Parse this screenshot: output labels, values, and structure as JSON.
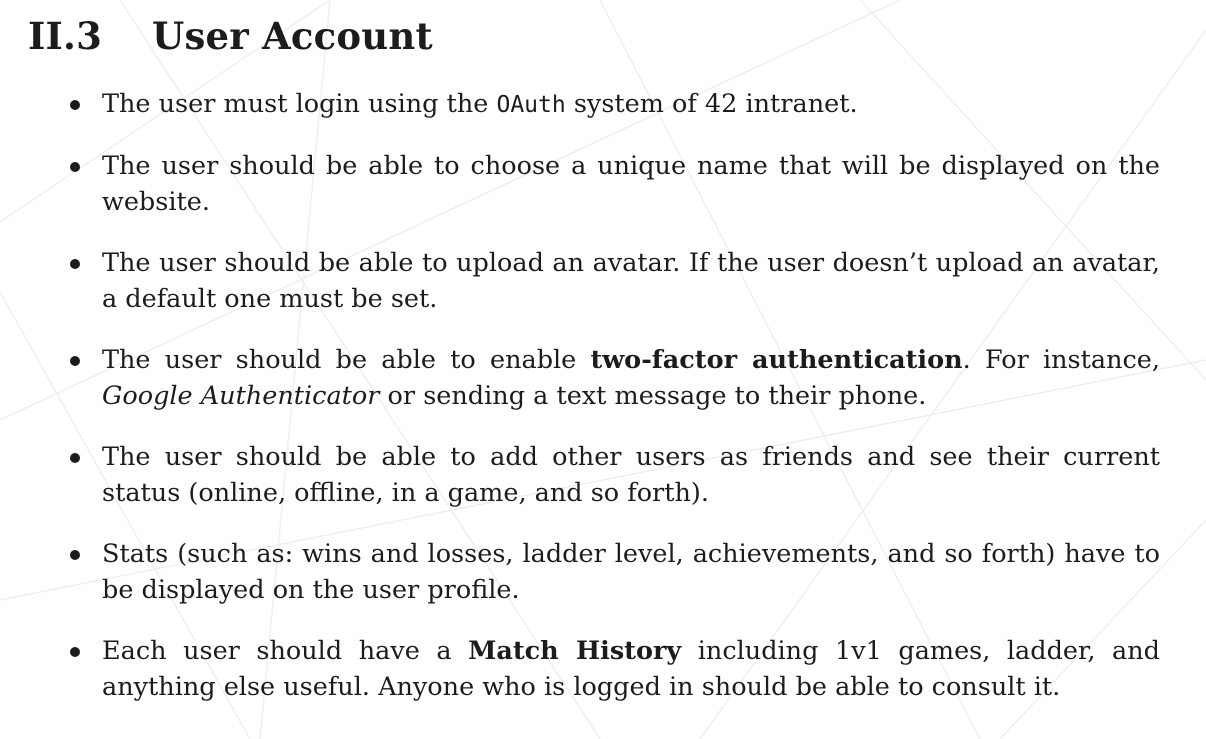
{
  "section": {
    "number": "II.3",
    "title": "User Account"
  },
  "items": [
    {
      "p1": "The user must login using the ",
      "code": "OAuth",
      "p2": " system of 42 intranet."
    },
    {
      "text": "The user should be able to choose a unique name that will be displayed on the website."
    },
    {
      "text": "The user should be able to upload an avatar. If the user doesn’t upload an avatar, a default one must be set."
    },
    {
      "p1": "The user should be able to enable ",
      "bold": "two-factor authentication",
      "p2": ". For instance, ",
      "italic": "Google Authenticator",
      "p3": " or sending a text message to their phone."
    },
    {
      "text": "The user should be able to add other users as friends and see their current status (online, offline, in a game, and so forth)."
    },
    {
      "text": "Stats (such as: wins and losses, ladder level, achievements, and so forth) have to be displayed on the user profile."
    },
    {
      "p1": "Each user should have a ",
      "bold": "Match History",
      "p2": " including 1v1 games, ladder, and anything else useful. Anyone who is logged in should be able to consult it."
    }
  ]
}
